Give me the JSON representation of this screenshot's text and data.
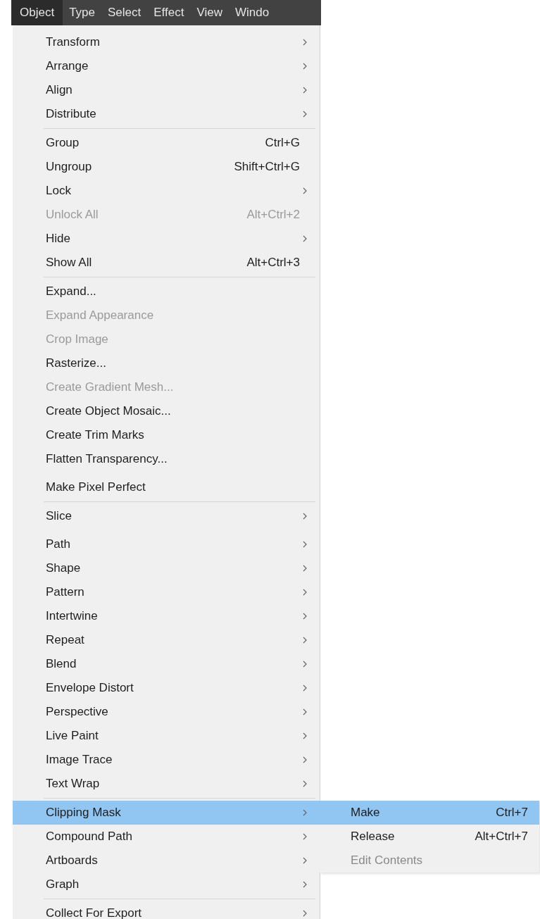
{
  "menu_bar": [
    {
      "label": "Object",
      "selected": true
    },
    {
      "label": "Type",
      "selected": false
    },
    {
      "label": "Select",
      "selected": false
    },
    {
      "label": "Effect",
      "selected": false
    },
    {
      "label": "View",
      "selected": false
    },
    {
      "label": "Windo",
      "selected": false
    }
  ],
  "menu": {
    "sections": [
      {
        "divider": false,
        "items": [
          {
            "label": "Transform",
            "submenu": true,
            "disabled": false,
            "selected": false
          },
          {
            "label": "Arrange",
            "submenu": true,
            "disabled": false,
            "selected": false
          },
          {
            "label": "Align",
            "submenu": true,
            "disabled": false,
            "selected": false
          },
          {
            "label": "Distribute",
            "submenu": true,
            "disabled": false,
            "selected": false
          }
        ]
      },
      {
        "divider": true,
        "items": [
          {
            "label": "Group",
            "shortcut": "Ctrl+G",
            "submenu": false,
            "disabled": false,
            "selected": false
          },
          {
            "label": "Ungroup",
            "shortcut": "Shift+Ctrl+G",
            "submenu": false,
            "disabled": false,
            "selected": false
          },
          {
            "label": "Lock",
            "submenu": true,
            "disabled": false,
            "selected": false
          },
          {
            "label": "Unlock All",
            "shortcut": "Alt+Ctrl+2",
            "submenu": false,
            "disabled": true,
            "selected": false
          },
          {
            "label": "Hide",
            "submenu": true,
            "disabled": false,
            "selected": false
          },
          {
            "label": "Show All",
            "shortcut": "Alt+Ctrl+3",
            "submenu": false,
            "disabled": false,
            "selected": false
          }
        ]
      },
      {
        "divider": true,
        "items": [
          {
            "label": "Expand...",
            "submenu": false,
            "disabled": false,
            "selected": false
          },
          {
            "label": "Expand Appearance",
            "submenu": false,
            "disabled": true,
            "selected": false
          },
          {
            "label": "Crop Image",
            "submenu": false,
            "disabled": true,
            "selected": false
          },
          {
            "label": "Rasterize...",
            "submenu": false,
            "disabled": false,
            "selected": false
          },
          {
            "label": "Create Gradient Mesh...",
            "submenu": false,
            "disabled": true,
            "selected": false
          },
          {
            "label": "Create Object Mosaic...",
            "submenu": false,
            "disabled": false,
            "selected": false
          },
          {
            "label": "Create Trim Marks",
            "submenu": false,
            "disabled": false,
            "selected": false
          },
          {
            "label": "Flatten Transparency...",
            "submenu": false,
            "disabled": false,
            "selected": false
          }
        ]
      },
      {
        "divider": false,
        "items": [
          {
            "label": "Make Pixel Perfect",
            "submenu": false,
            "disabled": false,
            "selected": false
          }
        ]
      },
      {
        "divider": true,
        "items": [
          {
            "label": "Slice",
            "submenu": true,
            "disabled": false,
            "selected": false
          }
        ]
      },
      {
        "divider": false,
        "items": [
          {
            "label": "Path",
            "submenu": true,
            "disabled": false,
            "selected": false
          },
          {
            "label": "Shape",
            "submenu": true,
            "disabled": false,
            "selected": false
          },
          {
            "label": "Pattern",
            "submenu": true,
            "disabled": false,
            "selected": false
          },
          {
            "label": "Intertwine",
            "submenu": true,
            "disabled": false,
            "selected": false
          },
          {
            "label": "Repeat",
            "submenu": true,
            "disabled": false,
            "selected": false
          },
          {
            "label": "Blend",
            "submenu": true,
            "disabled": false,
            "selected": false
          },
          {
            "label": "Envelope Distort",
            "submenu": true,
            "disabled": false,
            "selected": false
          },
          {
            "label": "Perspective",
            "submenu": true,
            "disabled": false,
            "selected": false
          },
          {
            "label": "Live Paint",
            "submenu": true,
            "disabled": false,
            "selected": false
          },
          {
            "label": "Image Trace",
            "submenu": true,
            "disabled": false,
            "selected": false
          },
          {
            "label": "Text Wrap",
            "submenu": true,
            "disabled": false,
            "selected": false
          }
        ]
      },
      {
        "divider": true,
        "items": [
          {
            "label": "Clipping Mask",
            "submenu": true,
            "disabled": false,
            "selected": true,
            "expanded": true,
            "children": [
              {
                "label": "Make",
                "shortcut": "Ctrl+7",
                "disabled": false,
                "selected": true
              },
              {
                "label": "Release",
                "shortcut": "Alt+Ctrl+7",
                "disabled": false,
                "selected": false
              },
              {
                "label": "Edit Contents",
                "disabled": true,
                "selected": false
              }
            ]
          },
          {
            "label": "Compound Path",
            "submenu": true,
            "disabled": false,
            "selected": false
          },
          {
            "label": "Artboards",
            "submenu": true,
            "disabled": false,
            "selected": false
          },
          {
            "label": "Graph",
            "submenu": true,
            "disabled": false,
            "selected": false
          }
        ]
      },
      {
        "divider": true,
        "items": [
          {
            "label": "Collect For Export",
            "submenu": true,
            "disabled": false,
            "selected": false
          }
        ]
      }
    ]
  }
}
